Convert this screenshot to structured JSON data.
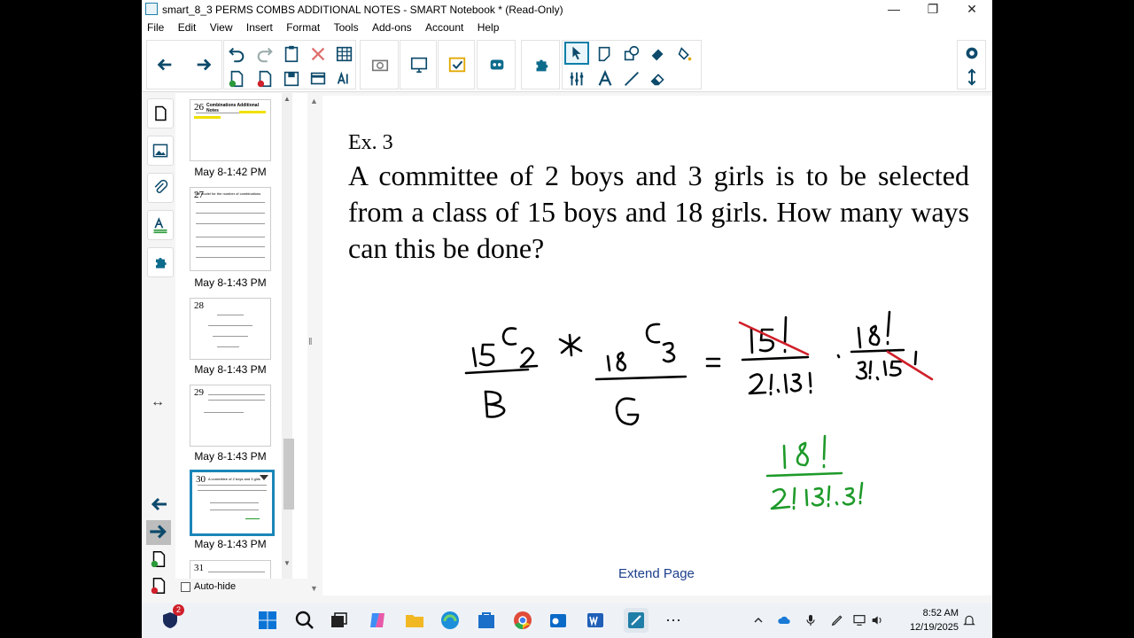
{
  "window": {
    "title": "smart_8_3 PERMS COMBS ADDITIONAL NOTES - SMART Notebook * (Read-Only)",
    "minimize_glyph": "—",
    "maximize_glyph": "❐",
    "close_glyph": "✕"
  },
  "menu": [
    "File",
    "Edit",
    "View",
    "Insert",
    "Format",
    "Tools",
    "Add-ons",
    "Account",
    "Help"
  ],
  "toolbar": {
    "icons": [
      "back-arrow-icon",
      "forward-arrow-icon",
      "undo-icon",
      "redo-icon",
      "paste-icon",
      "delete-icon",
      "table-icon",
      "add-page-icon",
      "delete-page-icon",
      "save-icon",
      "screen-shade-icon",
      "spelling-icon",
      "capture-icon",
      "screen-display-icon",
      "response-icon",
      "addon-icon",
      "puzzle-icon",
      "select-icon",
      "pen-icon",
      "shapes-icon",
      "fill-icon",
      "magic-pen-icon",
      "measure-icon",
      "text-icon",
      "line-icon",
      "eraser-icon",
      "gear-icon",
      "move-toolbar-icon"
    ]
  },
  "sidebar_tabs": [
    "page-sorter-icon",
    "gallery-icon",
    "attachments-icon",
    "properties-icon",
    "addons-icon"
  ],
  "sorter": {
    "thumbnails": [
      {
        "number": "26",
        "label": "May 8-1:42 PM",
        "heading": "Combinations Additional Notes"
      },
      {
        "number": "27",
        "label": "May 8-1:43 PM",
        "heading": "The model for the number of combinations"
      },
      {
        "number": "28",
        "label": "May 8-1:43 PM",
        "heading": ""
      },
      {
        "number": "29",
        "label": "May 8-1:43 PM",
        "heading": ""
      },
      {
        "number": "30",
        "label": "May 8-1:43 PM",
        "heading": "A committee of 2 boys and 3 girls"
      },
      {
        "number": "31",
        "label": "",
        "heading": ""
      }
    ],
    "autohide_label": "Auto-hide"
  },
  "canvas": {
    "example_label": "Ex. 3",
    "problem_text": "A committee of 2 boys and 3 girls is to be selected from a class of 15 boys and 18 girls. How many ways can this be done?",
    "extend_label": "Extend Page",
    "ink_color_black": "#000000",
    "ink_color_red": "#d0202a",
    "ink_color_green": "#1e9a2a"
  },
  "taskbar": {
    "notification_badge": "2",
    "time": "8:52 AM",
    "date": "12/19/2025"
  }
}
